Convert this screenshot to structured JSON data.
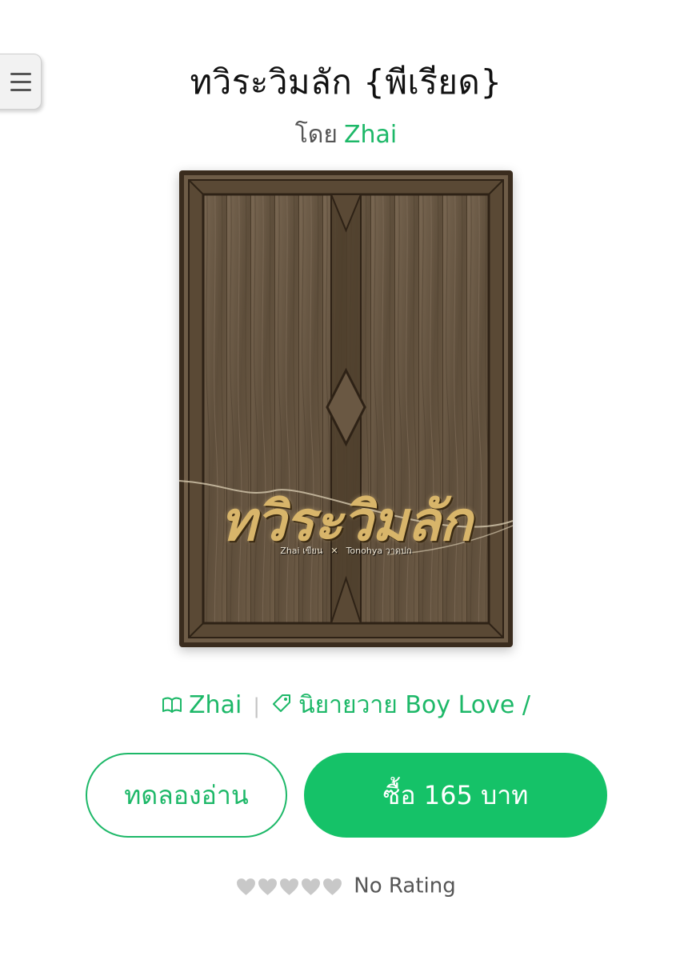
{
  "book": {
    "title": "ทวิระวิมลัก {พีเรียด}",
    "by_label": "โดย",
    "author": "Zhai"
  },
  "cover": {
    "title_text": "ทวิระวิมลัก",
    "credit_left": "Zhai เขียน",
    "credit_right": "Tonohya วาดปก",
    "wood_color": "#6b5a46",
    "frame_color": "#4a3a28"
  },
  "meta": {
    "writer": "Zhai",
    "separator": "|",
    "category": "นิยายวาย Boy Love /",
    "book_icon": "book-open-icon",
    "tag_icon": "tag-icon"
  },
  "actions": {
    "trial_label": "ทดลองอ่าน",
    "buy_label": "ซื้อ 165 บาท"
  },
  "rating": {
    "hearts_total": 5,
    "hearts_filled": 0,
    "label": "No Rating"
  },
  "colors": {
    "accent": "#1db868",
    "buy_bg": "#15c268",
    "heart_empty": "#c8c8c8"
  },
  "menu": {
    "icon": "hamburger-menu-icon"
  }
}
